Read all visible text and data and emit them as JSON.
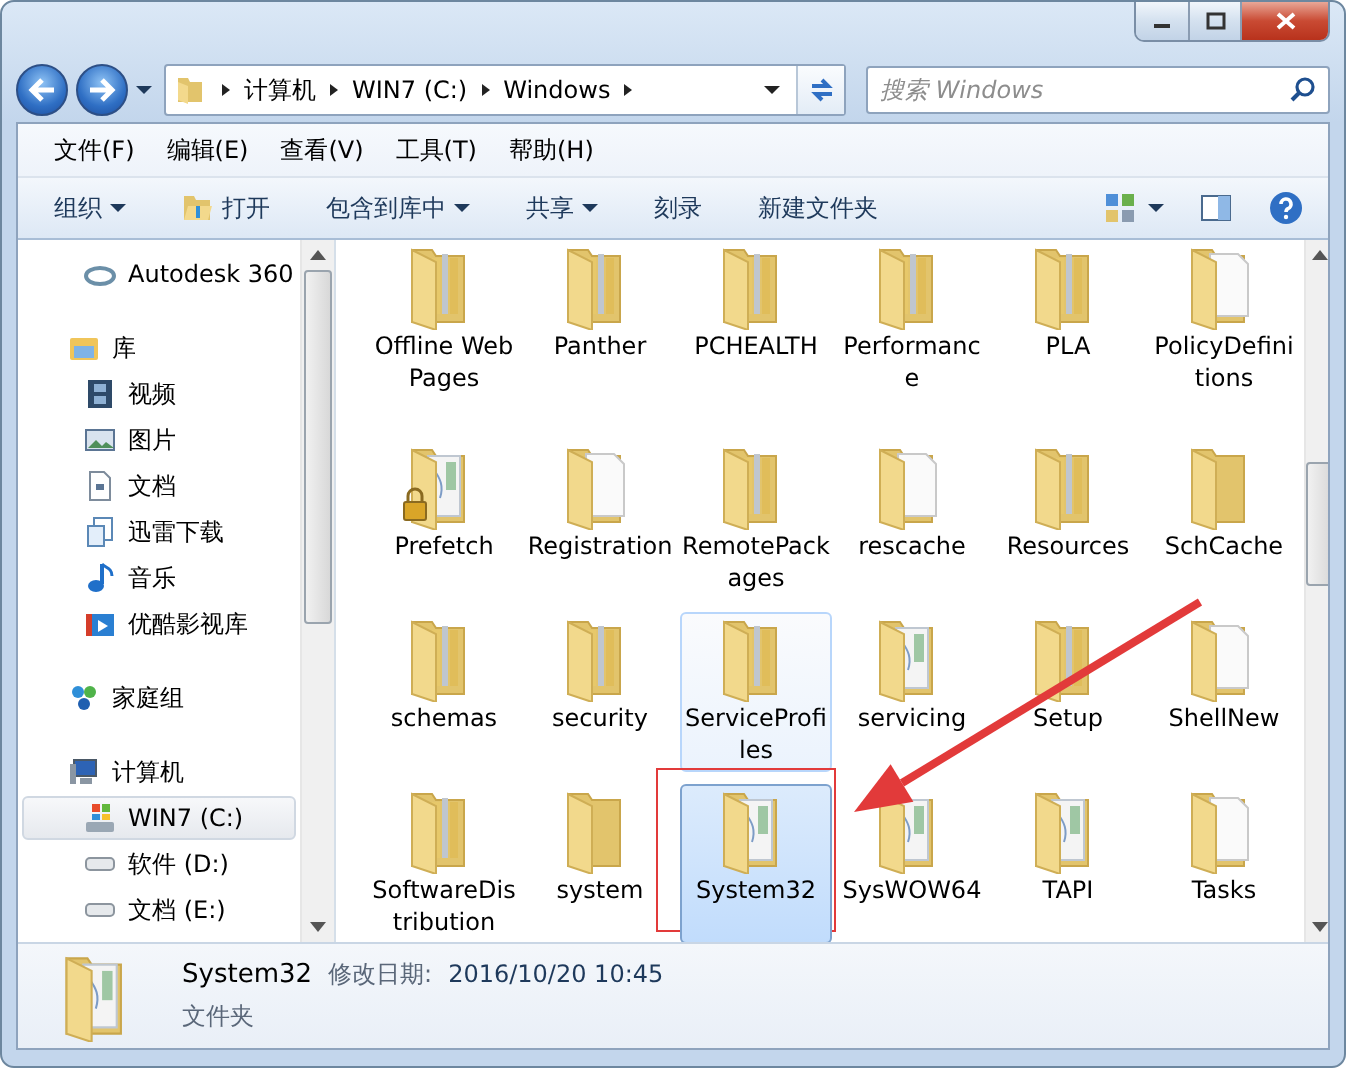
{
  "address": {
    "crumbs": [
      "计算机",
      "WIN7 (C:)",
      "Windows"
    ]
  },
  "search": {
    "placeholder": "搜索 Windows"
  },
  "menu": [
    "文件(F)",
    "编辑(E)",
    "查看(V)",
    "工具(T)",
    "帮助(H)"
  ],
  "toolbar": [
    {
      "label": "组织",
      "kind": "menu"
    },
    {
      "label": "打开",
      "kind": "icon"
    },
    {
      "label": "包含到库中",
      "kind": "menu"
    },
    {
      "label": "共享",
      "kind": "menu"
    },
    {
      "label": "刻录",
      "kind": "plain"
    },
    {
      "label": "新建文件夹",
      "kind": "plain"
    }
  ],
  "sidebar": {
    "items": [
      {
        "label": "Autodesk 360",
        "selected": false
      },
      {
        "label": "库",
        "selected": false,
        "children": [
          {
            "label": "视频",
            "selected": false
          },
          {
            "label": "图片",
            "selected": false
          },
          {
            "label": "文档",
            "selected": false
          },
          {
            "label": "迅雷下载",
            "selected": false
          },
          {
            "label": "音乐",
            "selected": false
          },
          {
            "label": "优酷影视库",
            "selected": false
          }
        ]
      },
      {
        "label": "家庭组",
        "selected": false
      },
      {
        "label": "计算机",
        "selected": false,
        "children": [
          {
            "label": "WIN7 (C:)",
            "selected": true
          },
          {
            "label": "软件 (D:)",
            "selected": false
          },
          {
            "label": "文档 (E:)",
            "selected": false
          }
        ]
      }
    ]
  },
  "folders": [
    {
      "name": "Offline Web Pages",
      "kind": "stack",
      "locked": false,
      "selected": false,
      "hover": false,
      "marked": false
    },
    {
      "name": "Panther",
      "kind": "stack",
      "locked": false,
      "selected": false,
      "hover": false,
      "marked": false
    },
    {
      "name": "PCHEALTH",
      "kind": "stack",
      "locked": false,
      "selected": false,
      "hover": false,
      "marked": false
    },
    {
      "name": "Performance",
      "kind": "stack",
      "locked": false,
      "selected": false,
      "hover": false,
      "marked": false
    },
    {
      "name": "PLA",
      "kind": "stack",
      "locked": false,
      "selected": false,
      "hover": false,
      "marked": false
    },
    {
      "name": "PolicyDefinitions",
      "kind": "paper",
      "locked": false,
      "selected": false,
      "hover": false,
      "marked": false
    },
    {
      "name": "Prefetch",
      "kind": "picture",
      "locked": true,
      "selected": false,
      "hover": false,
      "marked": false
    },
    {
      "name": "Registration",
      "kind": "paper",
      "locked": false,
      "selected": false,
      "hover": false,
      "marked": false
    },
    {
      "name": "RemotePackages",
      "kind": "stack",
      "locked": false,
      "selected": false,
      "hover": false,
      "marked": false
    },
    {
      "name": "rescache",
      "kind": "paper",
      "locked": false,
      "selected": false,
      "hover": false,
      "marked": false
    },
    {
      "name": "Resources",
      "kind": "stack",
      "locked": false,
      "selected": false,
      "hover": false,
      "marked": false
    },
    {
      "name": "SchCache",
      "kind": "empty",
      "locked": false,
      "selected": false,
      "hover": false,
      "marked": false
    },
    {
      "name": "schemas",
      "kind": "stack",
      "locked": false,
      "selected": false,
      "hover": false,
      "marked": false
    },
    {
      "name": "security",
      "kind": "stack",
      "locked": false,
      "selected": false,
      "hover": false,
      "marked": false
    },
    {
      "name": "ServiceProfiles",
      "kind": "stack",
      "locked": false,
      "selected": false,
      "hover": true,
      "marked": false
    },
    {
      "name": "servicing",
      "kind": "picture",
      "locked": false,
      "selected": false,
      "hover": false,
      "marked": false
    },
    {
      "name": "Setup",
      "kind": "stack",
      "locked": false,
      "selected": false,
      "hover": false,
      "marked": false
    },
    {
      "name": "ShellNew",
      "kind": "paper",
      "locked": false,
      "selected": false,
      "hover": false,
      "marked": false
    },
    {
      "name": "SoftwareDistribution",
      "kind": "stack",
      "locked": false,
      "selected": false,
      "hover": false,
      "marked": false
    },
    {
      "name": "system",
      "kind": "empty",
      "locked": false,
      "selected": false,
      "hover": false,
      "marked": false
    },
    {
      "name": "System32",
      "kind": "picture",
      "locked": false,
      "selected": true,
      "hover": false,
      "marked": true
    },
    {
      "name": "SysWOW64",
      "kind": "picture",
      "locked": false,
      "selected": false,
      "hover": false,
      "marked": false
    },
    {
      "name": "TAPI",
      "kind": "picture",
      "locked": false,
      "selected": false,
      "hover": false,
      "marked": false
    },
    {
      "name": "Tasks",
      "kind": "paper",
      "locked": false,
      "selected": false,
      "hover": false,
      "marked": false
    }
  ],
  "details": {
    "name": "System32",
    "date_label": "修改日期:",
    "date": "2016/10/20 10:45",
    "type": "文件夹"
  }
}
